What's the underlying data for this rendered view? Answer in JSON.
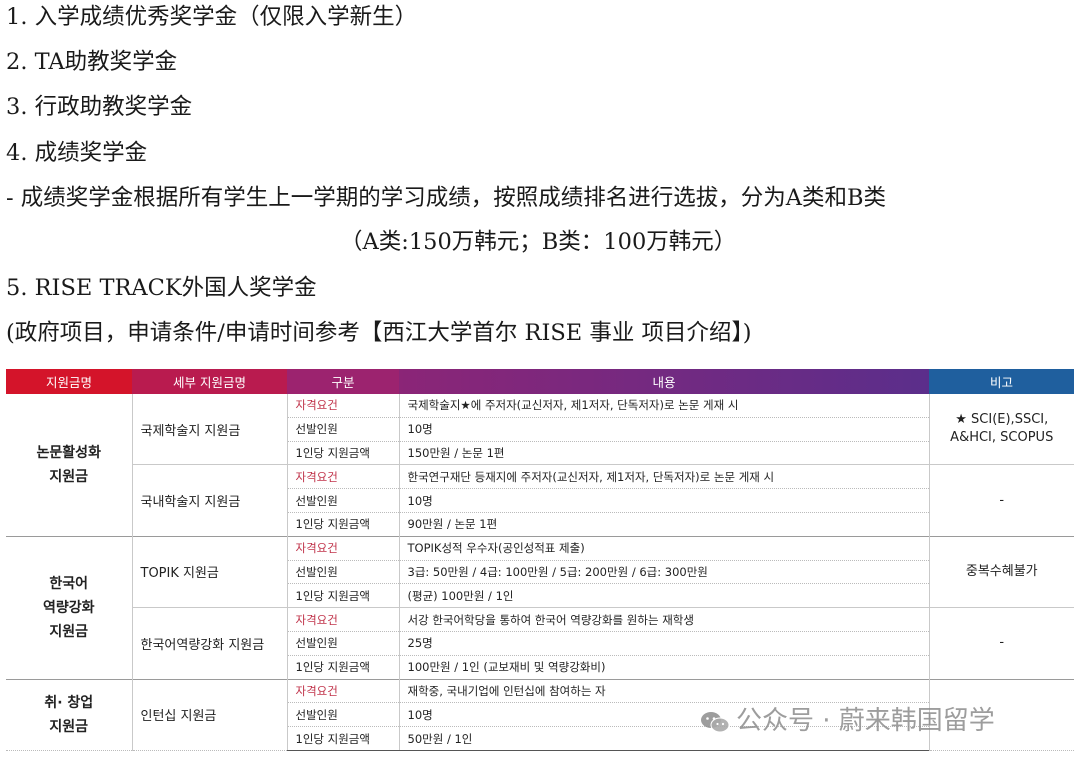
{
  "lines": [
    "1. 入学成绩优秀奖学金（仅限入学新生）",
    "2. TA助教奖学金",
    "3. 行政助教奖学金",
    "4. 成绩奖学金",
    "- 成绩奖学金根据所有学生上一学期的学习成绩，按照成绩排名进行选拔，分为A类和B类",
    "（A类:150万韩元；B类：100万韩元）",
    "5. RISE TRACK外国人奖学金",
    "(政府项目，申请条件/申请时间参考【西江大学首尔 RISE 事业 项目介绍】)"
  ],
  "table": {
    "headers": [
      "지원금명",
      "세부 지원금명",
      "구분",
      "내용",
      "비고"
    ],
    "cat1": "논문활성화\n지원금",
    "cat2": "한국어\n역량강화\n지원금",
    "cat3": "취· 창업\n지원금",
    "r1": {
      "sub": "국제학술지 지원금",
      "l": [
        "자격요건",
        "선발인원",
        "1인당 지원금액"
      ],
      "c": [
        "국제학술지★에 주저자(교신저자, 제1저자, 단독저자)로 논문 게재 시",
        "10명",
        "150만원 / 논문 1편"
      ],
      "note": "★ SCI(E),SSCI,\nA&HCI, SCOPUS"
    },
    "r2": {
      "sub": "국내학술지 지원금",
      "l": [
        "자격요건",
        "선발인원",
        "1인당 지원금액"
      ],
      "c": [
        "한국연구재단 등재지에 주저자(교신저자, 제1저자, 단독저자)로 논문 게재 시",
        "10명",
        "90만원 / 논문 1편"
      ],
      "note": "-"
    },
    "r3": {
      "sub": "TOPIK 지원금",
      "l": [
        "자격요건",
        "선발인원",
        "1인당 지원금액"
      ],
      "c": [
        "TOPIK성적 우수자(공인성적표 제출)",
        "3급: 50만원 / 4급: 100만원 / 5급: 200만원 / 6급: 300만원",
        "(평균) 100만원 / 1인"
      ],
      "note": "중복수혜불가"
    },
    "r4": {
      "sub": "한국어역량강화 지원금",
      "l": [
        "자격요건",
        "선발인원",
        "1인당 지원금액"
      ],
      "c": [
        "서강 한국어학당을 통하여 한국어 역량강화를 원하는 재학생",
        "25명",
        "100만원 / 1인 (교보재비 및 역량강화비)"
      ],
      "note": "-"
    },
    "r5": {
      "sub": "인턴십 지원금",
      "l": [
        "자격요건",
        "선발인원",
        "1인당 지원금액"
      ],
      "c": [
        "재학중, 국내기업에 인턴십에 참여하는 자",
        "10명",
        "50만원 / 1인"
      ],
      "note": ""
    }
  },
  "watermark": "公众号 · 蔚来韩国留学"
}
